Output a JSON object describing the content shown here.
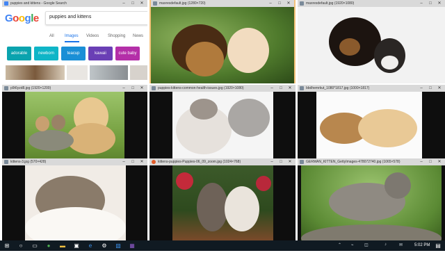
{
  "windows": {
    "google": {
      "title": "puppies and kittens - Google Search",
      "logo": [
        "G",
        "o",
        "o",
        "g",
        "l",
        "e"
      ],
      "logo_colors": [
        "#4285F4",
        "#EA4335",
        "#FBBC05",
        "#4285F4",
        "#34A853",
        "#EA4335"
      ],
      "query": "puppies and kittens",
      "tabs": [
        "All",
        "Images",
        "Videos",
        "Shopping",
        "News"
      ],
      "active_tab": "Images",
      "chips": [
        {
          "label": "adorable",
          "color": "#0aa3ae"
        },
        {
          "label": "newborn",
          "color": "#0fb5c7"
        },
        {
          "label": "teacup",
          "color": "#1a8fd6"
        },
        {
          "label": "kawaii",
          "color": "#6a3fb5"
        },
        {
          "label": "cute baby",
          "color": "#b42fa8"
        }
      ]
    },
    "w2": {
      "title": "maxresdefault.jpg (1280×720)"
    },
    "w3": {
      "title": "maxresdefault.jpg (1920×1080)"
    },
    "w4": {
      "title": "p9t6yzd8.jpg (1920×1200)"
    },
    "w5": {
      "title": "puppies-kittens-common-health-issues.jpg (1920×1080)"
    },
    "w6": {
      "title": "bbdhemrkut_1080*1817.jpg (1000×1817)"
    },
    "w7": {
      "title": "kittens-3.jpg (570×428)"
    },
    "w8": {
      "title": "kittens-puppies-Puppies-06_09_zoom.jpg (1024×768)"
    },
    "w9": {
      "title": "GERMAN_KITTEN_GettyImages-478072740.jpg (1065×578)"
    }
  },
  "taskbar": {
    "start_icon": "windows-start-icon",
    "apps": [
      {
        "name": "search-icon",
        "glyph": "○"
      },
      {
        "name": "task-view-icon",
        "glyph": "▭"
      },
      {
        "name": "chrome-icon",
        "glyph": "●"
      },
      {
        "name": "file-explorer-icon",
        "glyph": "▬"
      },
      {
        "name": "store-icon",
        "glyph": "▣"
      },
      {
        "name": "edge-icon",
        "glyph": "e"
      },
      {
        "name": "settings-icon",
        "glyph": "⚙"
      },
      {
        "name": "photos-icon",
        "glyph": "▧"
      },
      {
        "name": "onenote-icon",
        "glyph": "▦"
      }
    ],
    "tray": [
      "⌃",
      "⌁",
      "◫",
      "♪",
      "✉"
    ],
    "clock": "5:02 PM"
  }
}
